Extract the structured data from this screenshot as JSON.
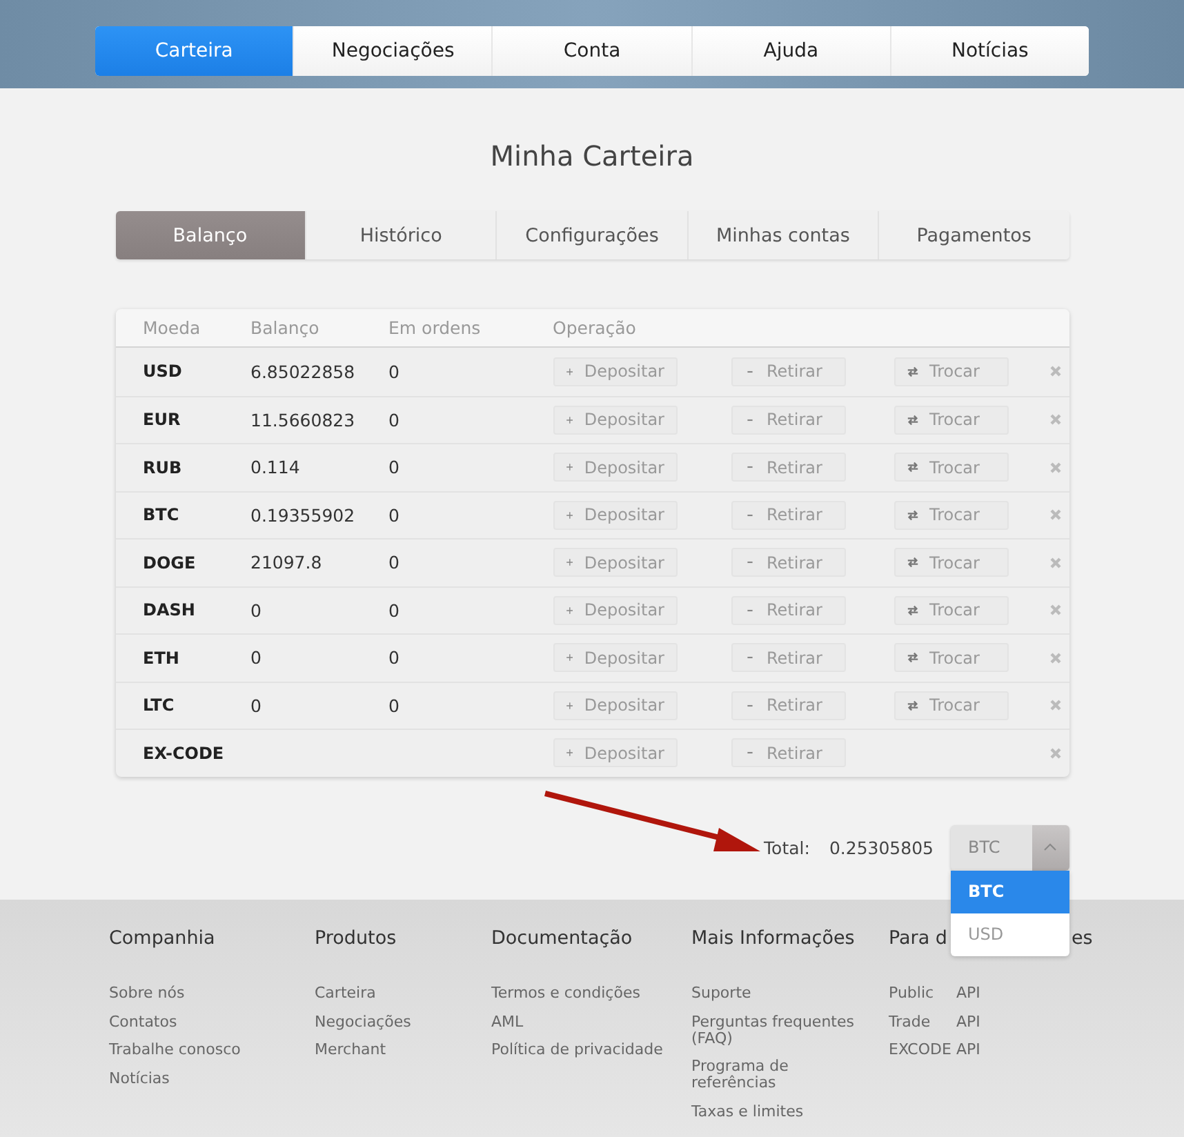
{
  "nav": [
    {
      "label": "Carteira",
      "selected": true
    },
    {
      "label": "Negociações",
      "selected": false
    },
    {
      "label": "Conta",
      "selected": false
    },
    {
      "label": "Ajuda",
      "selected": false
    },
    {
      "label": "Notícias",
      "selected": false
    }
  ],
  "title": "Minha Carteira",
  "tabs": [
    {
      "label": "Balanço",
      "selected": true
    },
    {
      "label": "Histórico",
      "selected": false
    },
    {
      "label": "Configurações",
      "selected": false
    },
    {
      "label": "Minhas contas",
      "selected": false
    },
    {
      "label": "Pagamentos",
      "selected": false
    }
  ],
  "table": {
    "columns": [
      "Moeda",
      "Balanço",
      "Em ordens",
      "Operação"
    ],
    "rows": [
      {
        "currency": "USD",
        "balance": "6.85022858",
        "orders": "0",
        "actions": [
          {
            "kind": "deposit",
            "label": "Depositar"
          },
          {
            "kind": "withdraw",
            "label": "Retirar"
          },
          {
            "kind": "exchange",
            "label": "Trocar"
          }
        ]
      },
      {
        "currency": "EUR",
        "balance": "11.5660823",
        "orders": "0",
        "actions": [
          {
            "kind": "deposit",
            "label": "Depositar"
          },
          {
            "kind": "withdraw",
            "label": "Retirar"
          },
          {
            "kind": "exchange",
            "label": "Trocar"
          }
        ]
      },
      {
        "currency": "RUB",
        "balance": "0.114",
        "orders": "0",
        "actions": [
          {
            "kind": "deposit",
            "label": "Depositar"
          },
          {
            "kind": "withdraw",
            "label": "Retirar"
          },
          {
            "kind": "exchange",
            "label": "Trocar"
          }
        ]
      },
      {
        "currency": "BTC",
        "balance": "0.19355902",
        "orders": "0",
        "actions": [
          {
            "kind": "deposit",
            "label": "Depositar"
          },
          {
            "kind": "withdraw",
            "label": "Retirar"
          },
          {
            "kind": "exchange",
            "label": "Trocar"
          }
        ]
      },
      {
        "currency": "DOGE",
        "balance": "21097.8",
        "orders": "0",
        "actions": [
          {
            "kind": "deposit",
            "label": "Depositar"
          },
          {
            "kind": "withdraw",
            "label": "Retirar"
          },
          {
            "kind": "exchange",
            "label": "Trocar"
          }
        ]
      },
      {
        "currency": "DASH",
        "balance": "0",
        "orders": "0",
        "actions": [
          {
            "kind": "deposit",
            "label": "Depositar"
          },
          {
            "kind": "withdraw",
            "label": "Retirar"
          },
          {
            "kind": "exchange",
            "label": "Trocar"
          }
        ]
      },
      {
        "currency": "ETH",
        "balance": "0",
        "orders": "0",
        "actions": [
          {
            "kind": "deposit",
            "label": "Depositar"
          },
          {
            "kind": "withdraw",
            "label": "Retirar"
          },
          {
            "kind": "exchange",
            "label": "Trocar"
          }
        ]
      },
      {
        "currency": "LTC",
        "balance": "0",
        "orders": "0",
        "actions": [
          {
            "kind": "deposit",
            "label": "Depositar"
          },
          {
            "kind": "withdraw",
            "label": "Retirar"
          },
          {
            "kind": "exchange",
            "label": "Trocar"
          }
        ]
      },
      {
        "currency": "EX-CODE",
        "actions": [
          {
            "kind": "deposit",
            "label": "Depositar"
          },
          {
            "kind": "withdraw",
            "label": "Retirar"
          }
        ]
      }
    ]
  },
  "total": {
    "label": "Total:",
    "value": "0.25305805",
    "select": {
      "value": "BTC",
      "expanded": true,
      "options": [
        {
          "label": "BTC",
          "selected": true
        },
        {
          "label": "USD",
          "selected": false
        }
      ]
    }
  },
  "footer": [
    {
      "title": "Companhia",
      "links": [
        {
          "label": "Sobre nós"
        },
        {
          "label": "Contatos"
        },
        {
          "label": "Trabalhe conosco"
        },
        {
          "label": "Notícias"
        }
      ]
    },
    {
      "title": "Produtos",
      "links": [
        {
          "label": "Carteira"
        },
        {
          "label": "Negociações"
        },
        {
          "label": "Merchant"
        }
      ]
    },
    {
      "title": "Documentação",
      "links": [
        {
          "label": "Termos e condições"
        },
        {
          "label": "AML"
        },
        {
          "label": "Política de privacidade"
        }
      ]
    },
    {
      "title": "Mais Informações",
      "links": [
        {
          "label": "Suporte"
        },
        {
          "label": "Perguntas frequentes (FAQ)"
        },
        {
          "label": "Programa de referências"
        },
        {
          "label": "Taxas e limites"
        }
      ]
    },
    {
      "title": "Para d",
      "title_end": "es",
      "links": [
        {
          "label": "Public",
          "suffix": "API"
        },
        {
          "label": "Trade",
          "suffix": "API"
        },
        {
          "label": "EXCODE",
          "suffix": "API"
        }
      ]
    }
  ]
}
